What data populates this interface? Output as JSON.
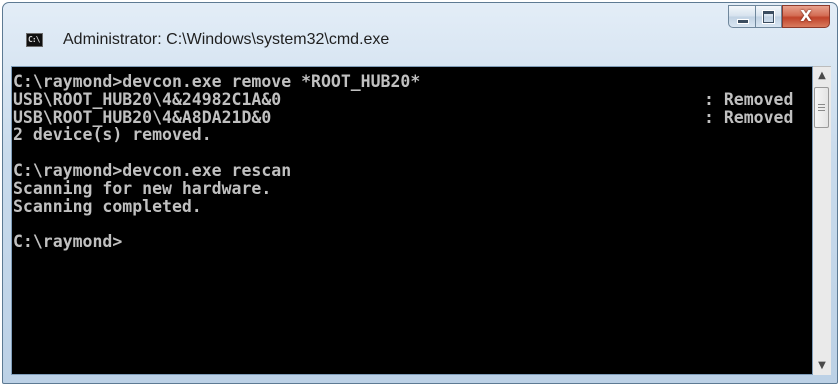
{
  "window": {
    "title": "Administrator: C:\\Windows\\system32\\cmd.exe",
    "icon_text": "C:\\",
    "close_glyph": "X"
  },
  "console": {
    "lines": [
      {
        "left": "C:\\raymond>devcon.exe remove *ROOT_HUB20*",
        "right": ""
      },
      {
        "left": "USB\\ROOT_HUB20\\4&24982C1A&0",
        "right": ": Removed"
      },
      {
        "left": "USB\\ROOT_HUB20\\4&A8DA21D&0",
        "right": ": Removed"
      },
      {
        "left": "2 device(s) removed.",
        "right": ""
      },
      {
        "left": "",
        "right": ""
      },
      {
        "left": "C:\\raymond>devcon.exe rescan",
        "right": ""
      },
      {
        "left": "Scanning for new hardware.",
        "right": ""
      },
      {
        "left": "Scanning completed.",
        "right": ""
      },
      {
        "left": "",
        "right": ""
      },
      {
        "left": "C:\\raymond>",
        "right": ""
      }
    ]
  },
  "scrollbar": {
    "up_glyph": "▲",
    "down_glyph": "▼"
  },
  "colors": {
    "console_background": "#000000",
    "console_text": "#c0c0c0",
    "close_button": "#c94a30"
  }
}
